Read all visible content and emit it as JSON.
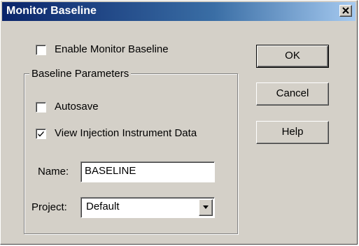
{
  "window": {
    "title": "Monitor Baseline"
  },
  "options": {
    "enable_monitor_baseline": {
      "label": "Enable Monitor Baseline",
      "checked": false
    }
  },
  "group": {
    "legend": "Baseline Parameters",
    "autosave": {
      "label": "Autosave",
      "checked": false
    },
    "view_injection": {
      "label": "View Injection Instrument Data",
      "checked": true
    },
    "name": {
      "label": "Name:",
      "value": "BASELINE"
    },
    "project": {
      "label": "Project:",
      "selected": "Default"
    }
  },
  "buttons": {
    "ok": "OK",
    "cancel": "Cancel",
    "help": "Help"
  },
  "colors": {
    "dialog_face": "#d4d0c8",
    "titlebar_start": "#0a246a",
    "titlebar_end": "#a6caf0"
  }
}
